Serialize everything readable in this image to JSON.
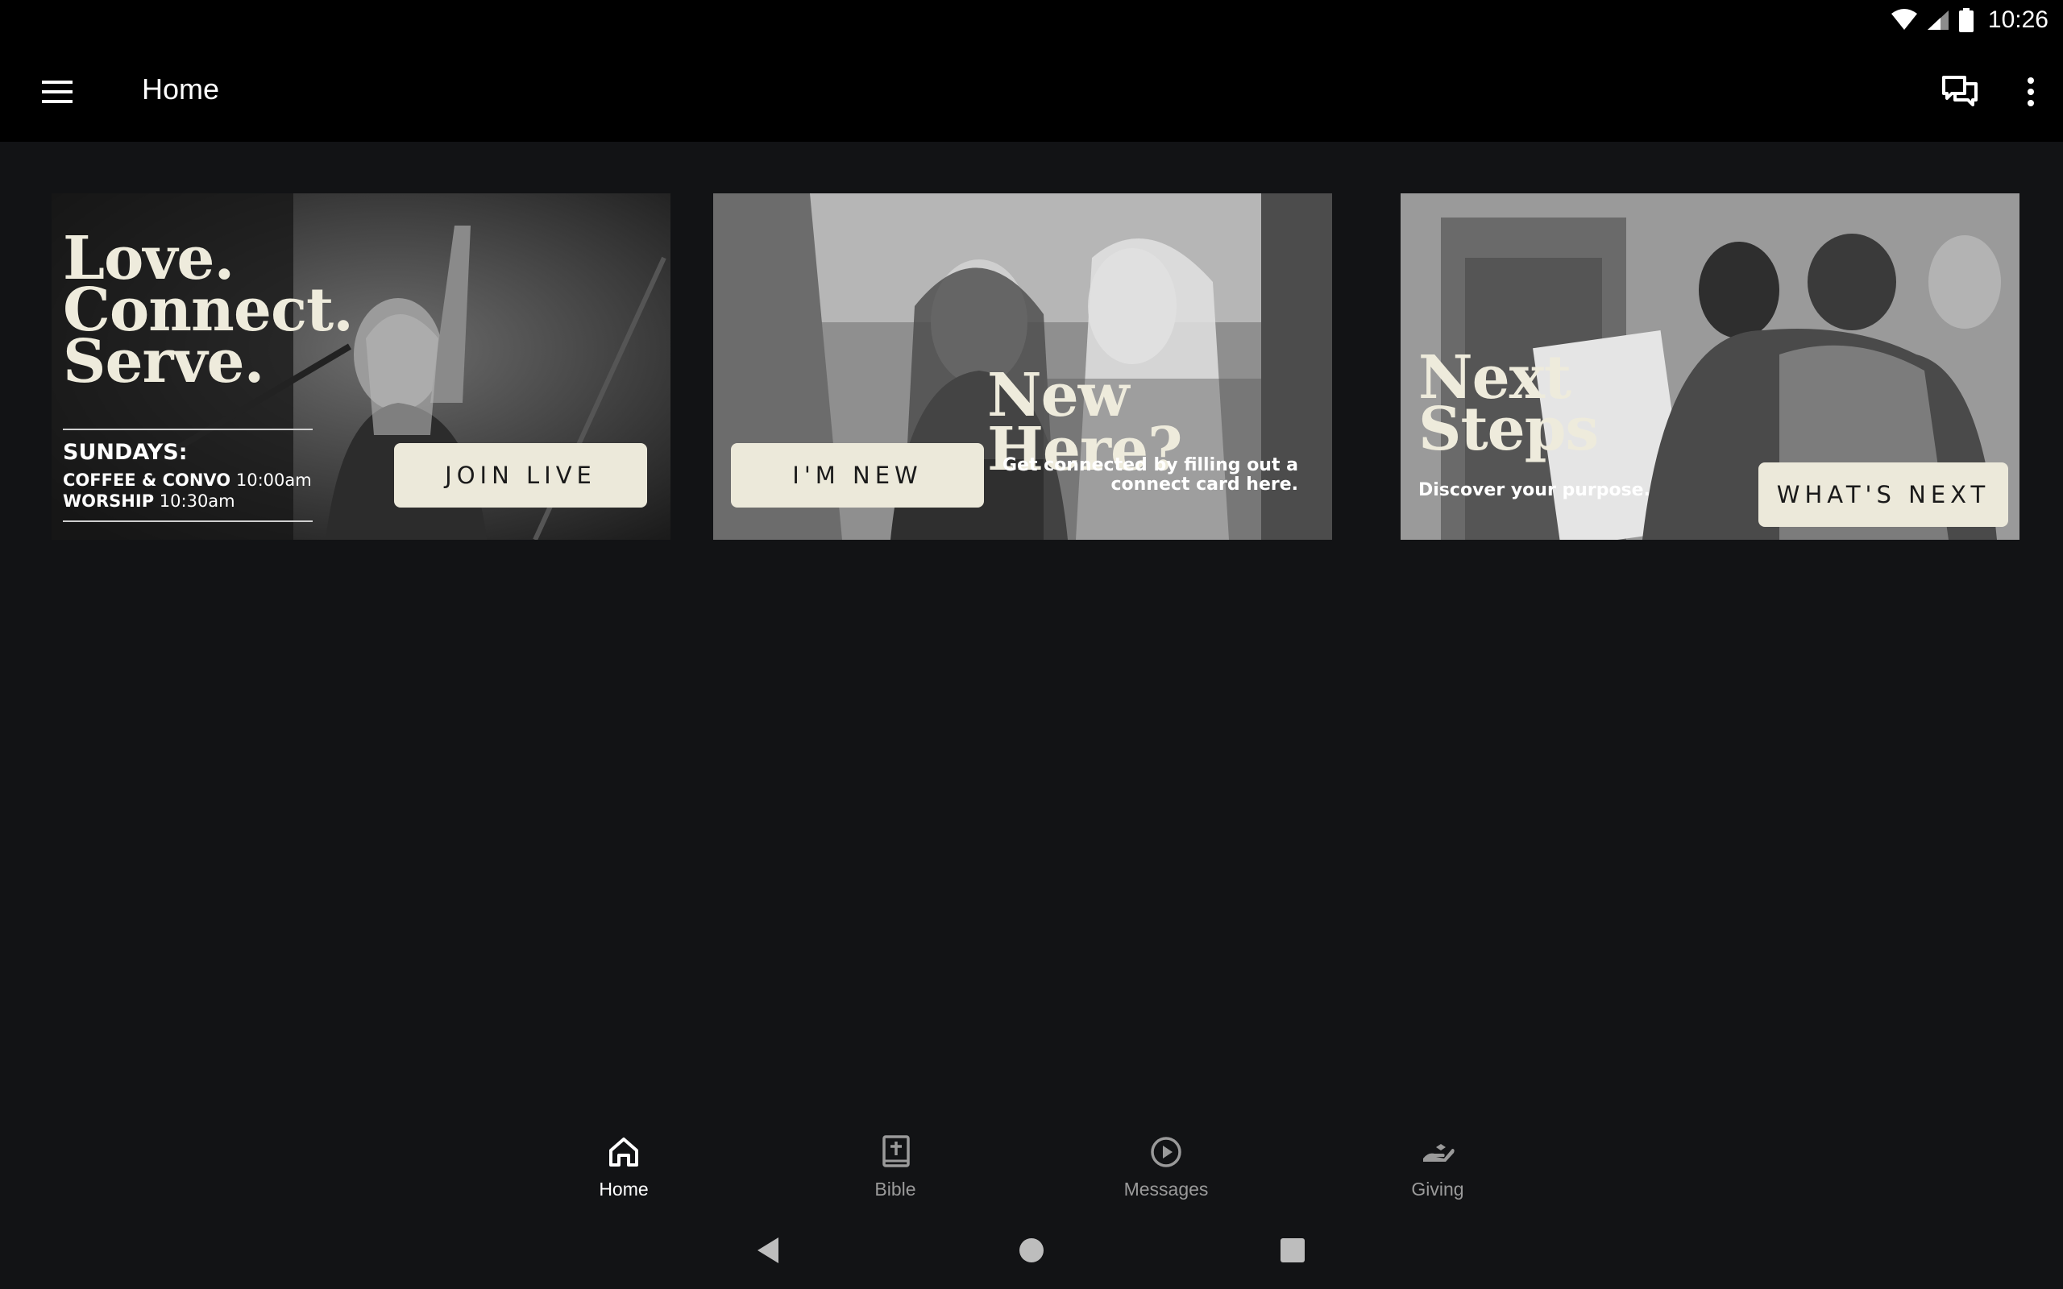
{
  "status_bar": {
    "time": "10:26"
  },
  "app_bar": {
    "title": "Home"
  },
  "cards": {
    "join_live": {
      "headline_1": "Love.",
      "headline_2": "Connect.",
      "headline_3": "Serve.",
      "sundays_label": "SUNDAYS:",
      "coffee_label": "COFFEE & CONVO",
      "coffee_time": "10:00am",
      "worship_label": "WORSHIP",
      "worship_time": "10:30am",
      "button": "JOIN LIVE"
    },
    "im_new": {
      "headline": "New Here?",
      "sub_line_1": "Get connected by filling out a",
      "sub_line_2": "connect card here.",
      "button": "I'M NEW"
    },
    "next_steps": {
      "headline_1": "Next",
      "headline_2": "Steps",
      "sub": "Discover your purpose.",
      "button": "WHAT'S NEXT"
    }
  },
  "bottom_nav": {
    "items": [
      {
        "label": "Home",
        "icon": "home-icon",
        "active": true
      },
      {
        "label": "Bible",
        "icon": "bible-icon",
        "active": false
      },
      {
        "label": "Messages",
        "icon": "play-circle-icon",
        "active": false
      },
      {
        "label": "Giving",
        "icon": "giving-hand-icon",
        "active": false
      }
    ]
  }
}
